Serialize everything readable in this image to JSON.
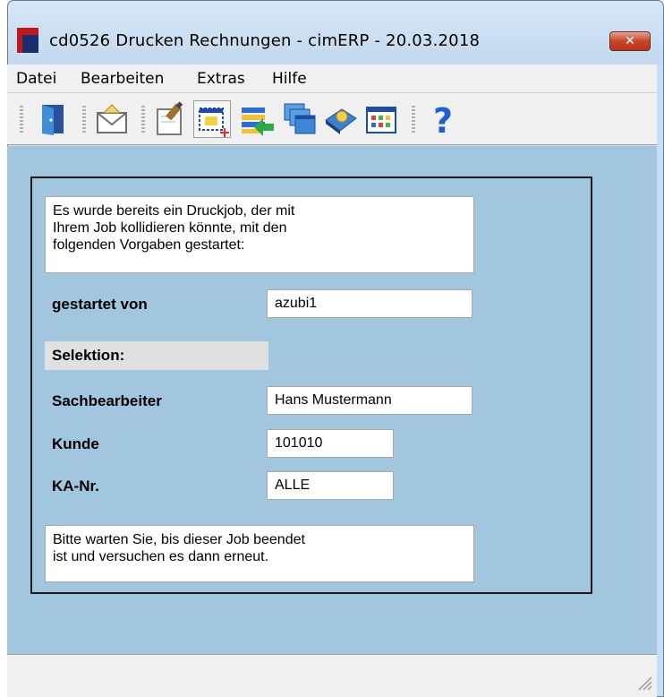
{
  "window": {
    "title": "cd0526 Drucken Rechnungen - cimERP - 20.03.2018",
    "close_label": "✕"
  },
  "menu": [
    "Datei",
    "Bearbeiten",
    "Extras",
    "Hilfe"
  ],
  "toolbar": {
    "icons": [
      "exit-door-icon",
      "mail-icon",
      "edit-form-icon",
      "new-record-icon",
      "import-list-icon",
      "windows-icon",
      "book-icon",
      "calendar-grid-icon",
      "help-icon"
    ]
  },
  "dialog": {
    "intro_lines": [
      "Es wurde bereits ein Druckjob, der mit",
      "Ihrem Job kollidieren könnte, mit den",
      "folgenden Vorgaben gestartet:"
    ],
    "started_by_label": "gestartet von",
    "started_by_value": "azubi1",
    "selection_label": "Selektion:",
    "clerk_label": "Sachbearbeiter",
    "clerk_value": "Hans Mustermann",
    "customer_label": "Kunde",
    "customer_value": "101010",
    "ka_label": "KA-Nr.",
    "ka_value": "ALLE",
    "wait_lines": [
      "Bitte warten Sie, bis dieser Job beendet",
      "ist und versuchen es dann erneut."
    ]
  }
}
